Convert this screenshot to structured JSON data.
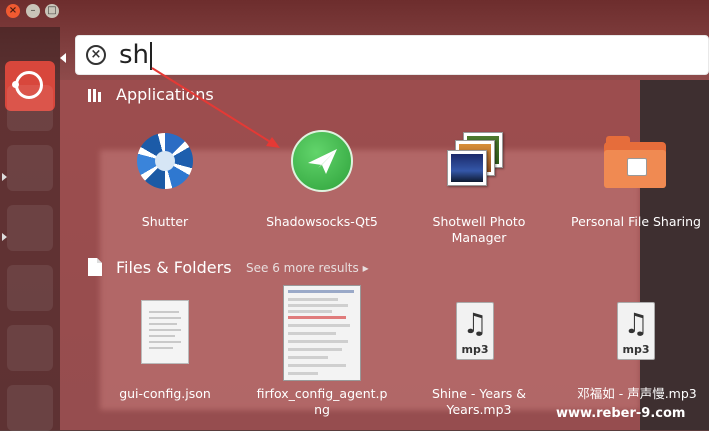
{
  "search": {
    "query": "sh"
  },
  "sections": {
    "applications": {
      "title": "Applications"
    },
    "files": {
      "title": "Files & Folders",
      "more": "See 6 more results"
    }
  },
  "applications": [
    {
      "label": "Shutter",
      "icon": "shutter-icon"
    },
    {
      "label": "Shadowsocks-Qt5",
      "icon": "shadowsocks-icon"
    },
    {
      "label_line1": "Shotwell Photo",
      "label_line2": "Manager",
      "icon": "shotwell-icon"
    },
    {
      "label": "Personal File Sharing",
      "icon": "file-sharing-icon"
    }
  ],
  "files": [
    {
      "label": "gui-config.json",
      "icon": "document-icon"
    },
    {
      "label_line1": "firfox_config_agent.p",
      "label_line2": "ng",
      "icon": "image-thumbnail-icon"
    },
    {
      "label_line1": "Shine - Years &",
      "label_line2": "Years.mp3",
      "icon": "mp3-icon"
    },
    {
      "label": "邓福如 - 声声慢.mp3",
      "icon": "mp3-icon"
    }
  ],
  "mp3_badge": "mp3",
  "watermark": "www.reber-9.com",
  "colors": {
    "accent": "#d8473c",
    "annotation": "#e53935"
  }
}
